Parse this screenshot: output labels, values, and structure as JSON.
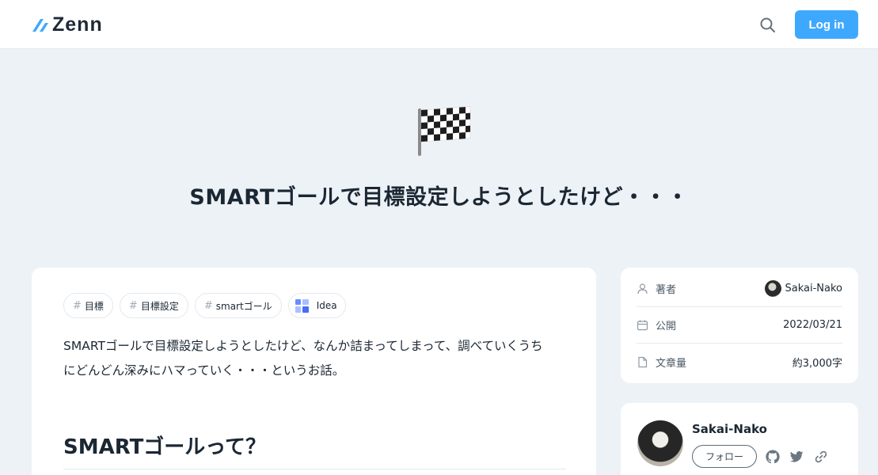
{
  "header": {
    "logo_text": "Zenn",
    "search_icon": "search-icon",
    "login_label": "Log in",
    "accent_color": "#3ea8ff"
  },
  "article": {
    "emoji": "checkered-flag",
    "title": "SMARTゴールで目標設定しようとしたけど・・・",
    "topics": [
      {
        "hash": "#",
        "label": "目標"
      },
      {
        "hash": "#",
        "label": "目標設定"
      },
      {
        "hash": "#",
        "label": "smartゴール"
      },
      {
        "label": "Idea",
        "icon": "idea-icon"
      }
    ],
    "lead_lines": [
      "SMARTゴールで目標設定しようとしたけど、なんか詰まってしまって、調べていくうち",
      "にどんどん深みにハマっていく・・・というお話。"
    ],
    "section_heading": "SMARTゴールって？"
  },
  "sidebar": {
    "info": [
      {
        "icon": "user-icon",
        "label": "著者",
        "value": "Sakai-Nako"
      },
      {
        "icon": "calendar-icon",
        "label": "公開",
        "value": "2022/03/21"
      },
      {
        "icon": "document-icon",
        "label": "文章量",
        "value": "約3,000字"
      }
    ],
    "author": {
      "name": "Sakai-Nako",
      "follow_label": "フォロー",
      "links": [
        "github-icon",
        "twitter-icon",
        "link-icon"
      ]
    }
  }
}
